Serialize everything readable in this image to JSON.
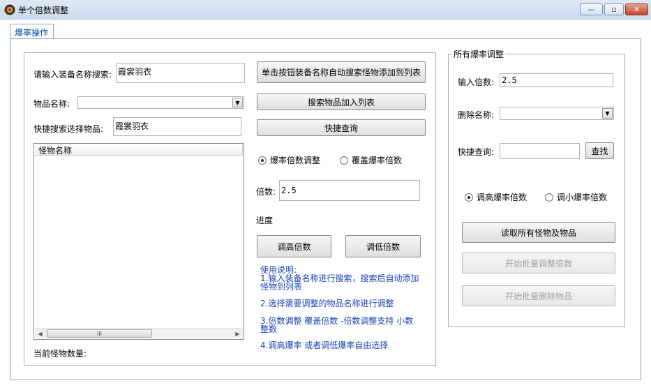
{
  "window": {
    "title": "单个倍数调整",
    "minimize_glyph": "—",
    "restore_glyph": "▫",
    "close_glyph": "✕"
  },
  "tab": {
    "label": "爆率操作"
  },
  "left": {
    "search_label": "请输入装备名称搜索:",
    "search_value": "霞裳羽衣",
    "auto_search_button": "单击按钮装备名称自动搜索怪物添加到列表",
    "item_name_label": "物品名称:",
    "item_name_value": "",
    "add_item_button": "搜索物品加入列表",
    "quick_select_label": "快捷搜索选择物品:",
    "quick_select_value": "霞裳羽衣",
    "quick_query_button": "快捷查询",
    "monster_list_header": "怪物名称",
    "monster_count_label": "当前怪物数量:",
    "radio_adjust": "爆率倍数调整",
    "radio_override": "覆盖爆率倍数",
    "radio_selected": "adjust",
    "multiplier_label": "倍数:",
    "multiplier_value": "2.5",
    "progress_label": "进度",
    "raise_button": "调高倍数",
    "lower_button": "调低倍数",
    "help": [
      "使用说明:",
      "1.输入装备名称进行搜索，搜索后自动添加",
      "怪物到列表",
      "2.选择需要调整的物品名称进行调整",
      "3.倍数调整 覆盖倍数 -倍数调整支持 小数",
      "整数",
      "4.调高爆率 或者调低爆率自由选择"
    ]
  },
  "right": {
    "group_title": "所有爆率调整",
    "input_multiplier_label": "输入倍数:",
    "input_multiplier_value": "2.5",
    "delete_name_label": "删除名称:",
    "delete_name_value": "",
    "quick_query_label": "快捷查询:",
    "quick_query_value": "",
    "find_button": "查找",
    "radio_raise": "调高爆率倍数",
    "radio_lower": "调小爆率倍数",
    "radio_selected": "raise",
    "read_all_button": "读取所有怪物及物品",
    "batch_adjust_button": "开始批量调整倍数",
    "batch_delete_button": "开始批量删除物品"
  },
  "scrollbar": {
    "thumb_grip": "III"
  },
  "colors": {
    "help_text": "#1a3fb4",
    "tab_text": "#0046a0",
    "close_button": "#c4442c"
  }
}
